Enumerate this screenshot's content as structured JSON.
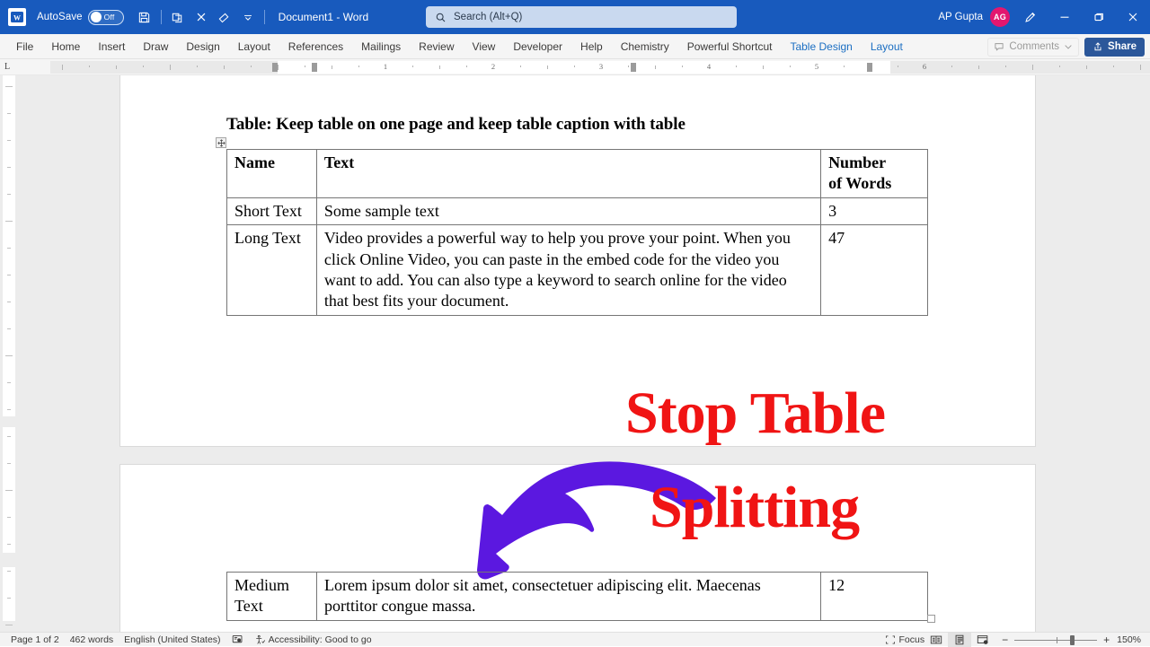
{
  "titlebar": {
    "app_icon": "word-logo-icon",
    "autosave_label": "AutoSave",
    "autosave_state": "Off",
    "document_title": "Document1  -  Word",
    "quick_access": [
      {
        "name": "save-button",
        "icon": "save-icon"
      },
      {
        "name": "compare-button",
        "icon": "copy-icon"
      },
      {
        "name": "close-button",
        "icon": "x-icon"
      },
      {
        "name": "highlighter-button",
        "icon": "eraser-icon"
      },
      {
        "name": "customize-qat-button",
        "icon": "chevron-down-icon"
      }
    ],
    "user_name": "AP Gupta",
    "avatar_initials": "AG",
    "pen_icon": "pen-icon",
    "minimize": "minimize-icon",
    "restore": "restore-icon",
    "close": "close-icon",
    "background": "#185ABD"
  },
  "search": {
    "placeholder": "Search (Alt+Q)",
    "icon": "search-icon"
  },
  "ribbon": {
    "tabs": [
      {
        "label": "File",
        "contextual": false
      },
      {
        "label": "Home",
        "contextual": false
      },
      {
        "label": "Insert",
        "contextual": false
      },
      {
        "label": "Draw",
        "contextual": false
      },
      {
        "label": "Design",
        "contextual": false
      },
      {
        "label": "Layout",
        "contextual": false
      },
      {
        "label": "References",
        "contextual": false
      },
      {
        "label": "Mailings",
        "contextual": false
      },
      {
        "label": "Review",
        "contextual": false
      },
      {
        "label": "View",
        "contextual": false
      },
      {
        "label": "Developer",
        "contextual": false
      },
      {
        "label": "Help",
        "contextual": false
      },
      {
        "label": "Chemistry",
        "contextual": false
      },
      {
        "label": "Powerful Shortcut",
        "contextual": false
      },
      {
        "label": "Table Design",
        "contextual": true
      },
      {
        "label": "Layout",
        "contextual": true
      }
    ],
    "comments_label": "Comments",
    "comments_icon": "comment-icon",
    "comments_chevron": "chevron-down-icon",
    "share_label": "Share",
    "share_icon": "share-icon",
    "contextual_color": "#1b6ec2",
    "share_color": "#2b579a"
  },
  "ruler": {
    "corner_marker": "L",
    "numbers": [
      "1",
      "2",
      "3",
      "4",
      "5",
      "6"
    ]
  },
  "document": {
    "heading": "Table: Keep table on one page and keep table caption with table",
    "table_move_handle": "table-move-handle-icon",
    "table1": {
      "headers": [
        "Name",
        "Text",
        "Number of Words"
      ],
      "headers_parts": [
        [
          "Name"
        ],
        [
          "Text"
        ],
        [
          "Number",
          "of Words"
        ]
      ],
      "rows": [
        {
          "name": "Short Text",
          "text": "Some sample text",
          "words": "3"
        },
        {
          "name": "Long Text",
          "text": "Video provides a powerful way to help you prove your point. When you click Online Video, you can paste in the embed code for the video you want to add. You can also type a keyword to search online for the video that best fits your document.",
          "words": "47"
        }
      ]
    },
    "table2": {
      "rows": [
        {
          "name": "Medium Text",
          "text": "Lorem ipsum dolor sit amet, consectetuer adipiscing elit. Maecenas porttitor congue massa.",
          "words": "12"
        }
      ]
    }
  },
  "annotations": {
    "arrow": {
      "name": "curved-arrow-annotation",
      "color": "#5B18E0"
    },
    "text_line1": "Stop Table",
    "text_line2": "Splitting",
    "text_color": "#f01414"
  },
  "statusbar": {
    "page_info": "Page 1 of 2",
    "word_count": "462 words",
    "language": "English (United States)",
    "proofing_icon": "proofing-icon",
    "accessibility_icon": "accessibility-icon",
    "accessibility": "Accessibility: Good to go",
    "focus_label": "Focus",
    "focus_icon": "focus-icon",
    "view_read_icon": "read-mode-icon",
    "view_print_icon": "print-layout-icon",
    "view_web_icon": "web-layout-icon",
    "zoom_out": "−",
    "zoom_in": "+",
    "zoom_level": "150%"
  }
}
